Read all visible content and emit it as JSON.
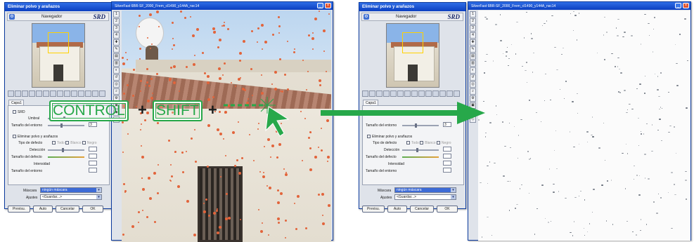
{
  "panel": {
    "title": "Eliminar polvo y arañazos",
    "navigator_label": "Navegador",
    "brand": "SRD",
    "layer_tab": "Capa1",
    "srd_checkbox": "SRD",
    "threshold_label": "Umbral",
    "env_size_label": "Tamaño del entorno",
    "env_size_value": "3",
    "remove_dust_checkbox": "Eliminar polvo y arañazos",
    "defect_type_label": "Tipo de defecto",
    "defect_options": [
      "Todo",
      "Blanco",
      "Negro"
    ],
    "detection_label": "Detección",
    "defect_size_label": "Tamaño del defecto",
    "intensity_label": "Intensidad",
    "env_size2_label": "Tamaño del entorno",
    "mask_label": "Máscara",
    "mask_value": "ningún máscara",
    "settings_label": "Ajustes",
    "settings_value": "<Guardar...>",
    "buttons": {
      "preview": "Previsu.",
      "auto": "Auto",
      "cancel": "Cancelar",
      "ok": "OK"
    }
  },
  "image_window": {
    "title_left": "SilverFast 6BR-SF_2000_Frem_cl1490_y144A_nsc14",
    "title_right": "SilverFast 6BR-SF_2000_Frem_cl1490_y144A_nsc14"
  },
  "overlay": {
    "key1": "CONTROL",
    "plus1": "+",
    "key2": "SHIFT",
    "plus2": "+",
    "arrow_color": "#27a84a"
  }
}
